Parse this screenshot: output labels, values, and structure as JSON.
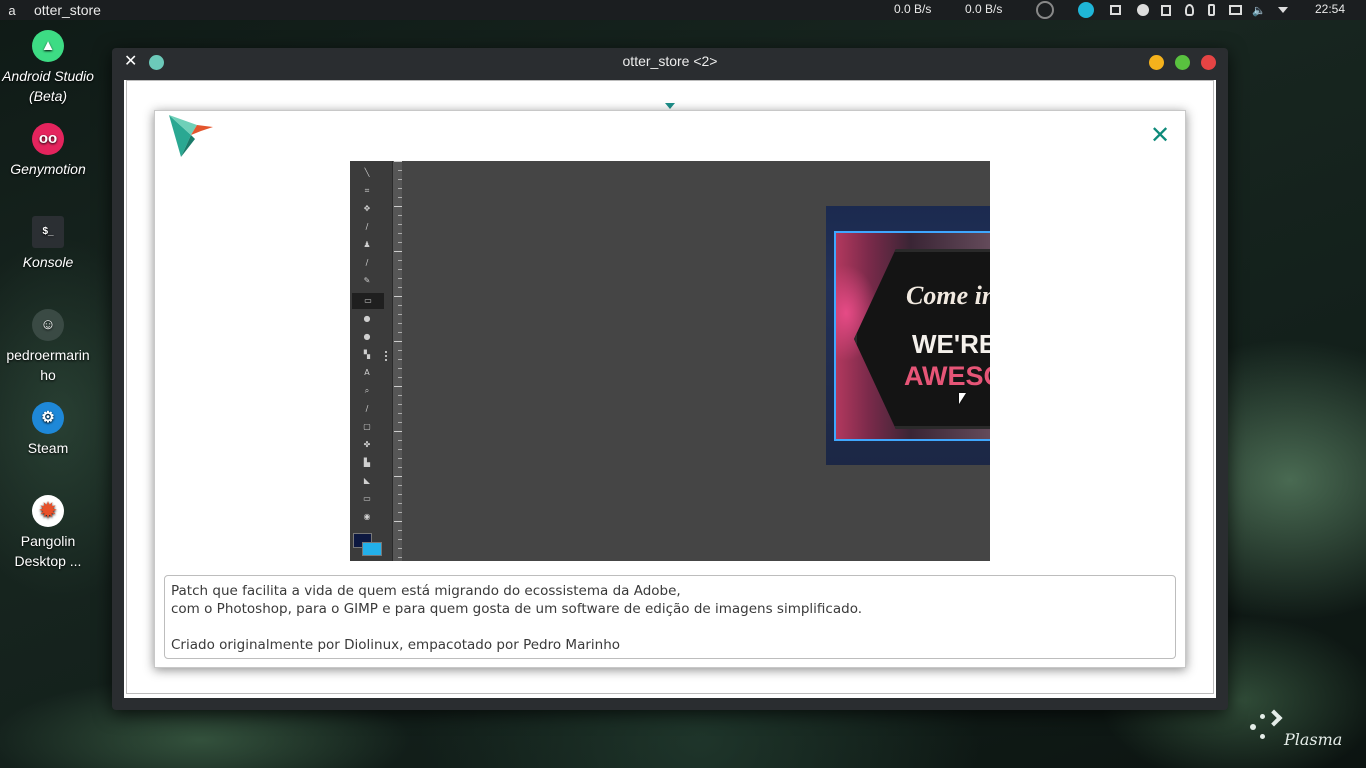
{
  "panel": {
    "launcher_glyph": "a",
    "active_app": "otter_store",
    "net_down": "0.0 B/s",
    "net_up": "0.0 B/s",
    "clock": "22:54",
    "tray_icons": [
      "network-monitor-icon",
      "sync-icon",
      "window-icon",
      "pause-icon",
      "clipboard-icon",
      "bulb-icon",
      "phone-icon",
      "display-icon",
      "volume-icon",
      "expand-tray-icon"
    ]
  },
  "desktop_icons": [
    {
      "label": "Android Studio (Beta)",
      "icon": "android-studio-icon",
      "color": "#3ddc84"
    },
    {
      "label": "Genymotion",
      "icon": "genymotion-icon",
      "color": "#e4245d"
    },
    {
      "label": "Konsole",
      "icon": "konsole-icon",
      "color": "#2b2f33"
    },
    {
      "label": "pedroermarinho",
      "icon": "user-avatar-icon",
      "color": "#3a4a44"
    },
    {
      "label": "Steam",
      "icon": "steam-icon",
      "color": "#1e88d8"
    },
    {
      "label": "Pangolin Desktop ...",
      "icon": "pangolin-icon",
      "color": "#e8502a"
    }
  ],
  "window": {
    "title": "otter_store <2>",
    "colors": {
      "minimize": "#f5b21c",
      "maximize": "#59c13f",
      "close": "#e54444",
      "pin": "#6cc9b9"
    }
  },
  "dialog": {
    "close_glyph": "✕",
    "accent": "#0e8a7a",
    "description_lines": [
      "Patch que facilita a vida de quem está migrando do ecossistema da Adobe,",
      "com o Photoshop, para o GIMP e para quem gosta de um software de edição de imagens simplificado."
    ],
    "credits": "Criado originalmente por Diolinux, empacotado por Pedro Marinho"
  },
  "screenshot": {
    "sign_line1": "Come in",
    "sign_line2": "WE'RE",
    "sign_line3": "AWESOME"
  },
  "wallpaper": {
    "brand": "Plasma"
  }
}
